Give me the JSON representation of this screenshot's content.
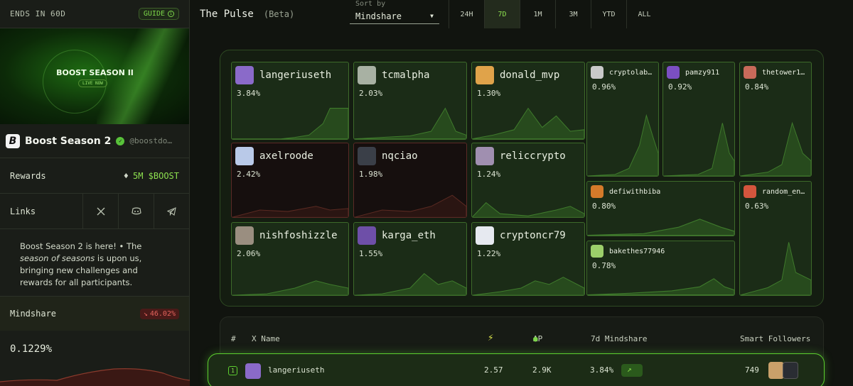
{
  "sidebar": {
    "ends_in": "ENDS IN 60D",
    "guide_label": "GUIDE",
    "banner_title": "BOOST SEASON II",
    "banner_live": "LIVE NOW",
    "project_logo": "B",
    "project_name": "Boost Season 2",
    "project_handle": "@boostdo…",
    "rewards_label": "Rewards",
    "rewards_value": "5M $BOOST",
    "links_label": "Links",
    "desc_1": "Boost Season 2 is here! • The ",
    "desc_em": "season of seasons",
    "desc_2": " is upon us, bringing new challenges and rewards for all participants.",
    "mindshare_label": "Mindshare",
    "mindshare_change": "46.02%",
    "mindshare_value": "0.1229%",
    "icons": {
      "guide": "info-icon",
      "verified": "check-badge-icon",
      "eth": "ethereum-icon",
      "x": "x-icon",
      "discord": "discord-icon",
      "telegram": "telegram-icon",
      "down": "trend-down-icon"
    }
  },
  "header": {
    "title": "The Pulse",
    "beta": "(Beta)",
    "sort_label": "Sort by",
    "sort_value": "Mindshare",
    "tabs": [
      "24H",
      "7D",
      "1M",
      "3M",
      "YTD",
      "ALL"
    ],
    "active_tab": "7D"
  },
  "treemap": [
    {
      "name": "langeriuseth",
      "pct": "3.84%",
      "color": "#8a6ac9",
      "trend": "up"
    },
    {
      "name": "tcmalpha",
      "pct": "2.03%",
      "color": "#a8b1a3",
      "trend": "up"
    },
    {
      "name": "donald_mvp",
      "pct": "1.30%",
      "color": "#e0a34a",
      "trend": "up"
    },
    {
      "name": "cryptolab…",
      "pct": "0.96%",
      "color": "#c9c9c9",
      "trend": "up"
    },
    {
      "name": "pamzy911",
      "pct": "0.92%",
      "color": "#7b4fc2",
      "trend": "up"
    },
    {
      "name": "thetower1…",
      "pct": "0.84%",
      "color": "#c86a5a",
      "trend": "up"
    },
    {
      "name": "axelroode",
      "pct": "2.42%",
      "color": "#b9c9e8",
      "trend": "down"
    },
    {
      "name": "nqciao",
      "pct": "1.98%",
      "color": "#3a3f48",
      "trend": "down"
    },
    {
      "name": "reliccrypto",
      "pct": "1.24%",
      "color": "#a08fb0",
      "trend": "up"
    },
    {
      "name": "defiwithbiba",
      "pct": "0.80%",
      "color": "#d47a2a",
      "trend": "up"
    },
    {
      "name": "random_en…",
      "pct": "0.63%",
      "color": "#d4553d",
      "trend": "up"
    },
    {
      "name": "nishfoshizzle",
      "pct": "2.06%",
      "color": "#9a8e80",
      "trend": "up"
    },
    {
      "name": "karga_eth",
      "pct": "1.55%",
      "color": "#6e4fa8",
      "trend": "up"
    },
    {
      "name": "cryptoncr79",
      "pct": "1.22%",
      "color": "#e6e9f0",
      "trend": "up"
    },
    {
      "name": "bakethes77946",
      "pct": "0.78%",
      "color": "#9ccf6a",
      "trend": "up"
    }
  ],
  "table": {
    "headers": {
      "rank": "#",
      "name": "X Name",
      "ap": "AP",
      "mindshare": "7d Mindshare",
      "followers": "Smart Followers"
    },
    "rows": [
      {
        "rank": "1",
        "name": "langeriuseth",
        "score": "2.57",
        "ap": "2.9K",
        "mindshare": "3.84%",
        "followers": "749"
      }
    ]
  }
}
